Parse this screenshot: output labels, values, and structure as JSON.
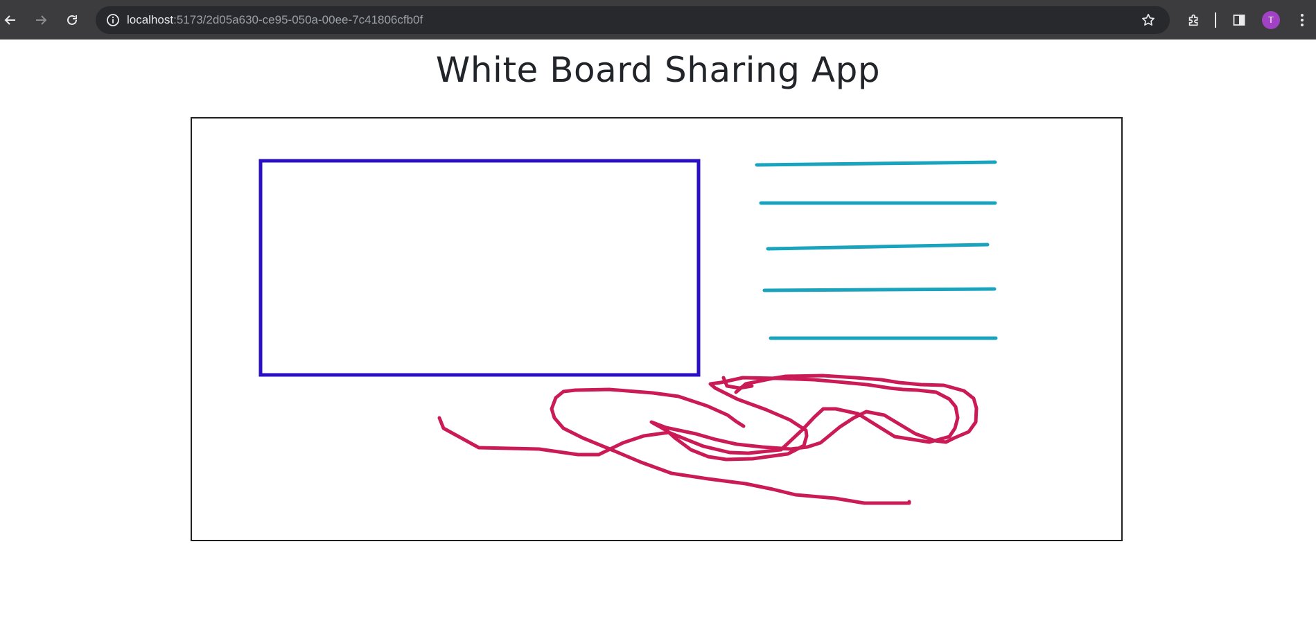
{
  "browser": {
    "url_host": "localhost",
    "url_rest": ":5173/2d05a630-ce95-050a-00ee-7c41806cfb0f",
    "profile_initial": "T",
    "icons": [
      "back-arrow-icon",
      "forward-arrow-icon",
      "reload-icon",
      "site-info-icon",
      "bookmark-star-icon",
      "extensions-icon",
      "side-panel-icon",
      "more-menu-icon"
    ]
  },
  "page": {
    "title": "White Board Sharing App"
  },
  "whiteboard": {
    "stroke_colors": {
      "rectangle": "#2a0fc4",
      "lines": "#1aa3bd",
      "freehand": "#cb1b57"
    }
  }
}
